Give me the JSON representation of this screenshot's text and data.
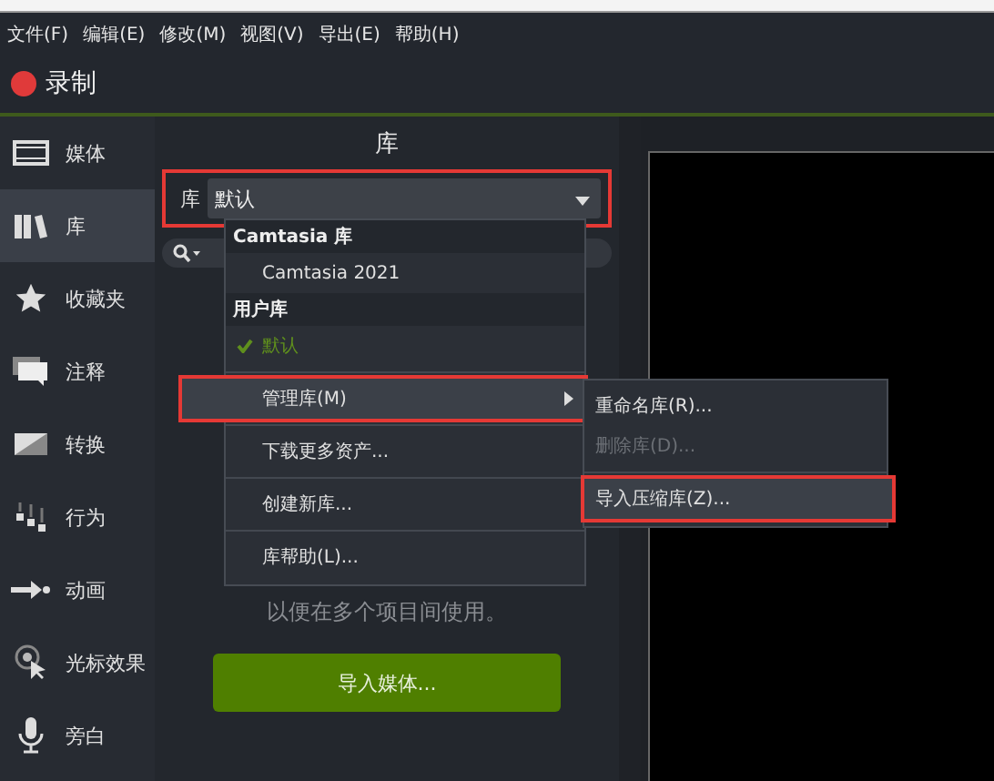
{
  "menubar": [
    "文件(F)",
    "编辑(E)",
    "修改(M)",
    "视图(V)",
    "导出(E)",
    "帮助(H)"
  ],
  "record": {
    "label": "录制"
  },
  "sidebar": {
    "items": [
      {
        "kind": "media",
        "label": "媒体",
        "selected": false
      },
      {
        "kind": "library",
        "label": "库",
        "selected": true
      },
      {
        "kind": "favorites",
        "label": "收藏夹",
        "selected": false
      },
      {
        "kind": "annotations",
        "label": "注释",
        "selected": false
      },
      {
        "kind": "transitions",
        "label": "转换",
        "selected": false
      },
      {
        "kind": "behaviors",
        "label": "行为",
        "selected": false
      },
      {
        "kind": "animations",
        "label": "动画",
        "selected": false
      },
      {
        "kind": "cursor",
        "label": "光标效果",
        "selected": false
      },
      {
        "kind": "voice",
        "label": "旁白",
        "selected": false
      }
    ]
  },
  "library_panel": {
    "title": "库",
    "select_label": "库",
    "select_value": "默认",
    "select_highlighted": true,
    "hint": "以便在多个项目间使用。",
    "import_button": "导入媒体..."
  },
  "dropdown_menu": {
    "items": [
      {
        "kind": "header",
        "label": "Camtasia 库"
      },
      {
        "kind": "item",
        "label": "Camtasia 2021",
        "selected": false
      },
      {
        "kind": "header",
        "label": "用户库"
      },
      {
        "kind": "item",
        "label": "默认",
        "selected": true
      },
      {
        "kind": "separator"
      },
      {
        "kind": "submenu",
        "label": "管理库(M)",
        "highlighted": true
      },
      {
        "kind": "separator"
      },
      {
        "kind": "item",
        "label": "下载更多资产...",
        "selected": false
      },
      {
        "kind": "separator"
      },
      {
        "kind": "item",
        "label": "创建新库...",
        "selected": false
      },
      {
        "kind": "separator"
      },
      {
        "kind": "item",
        "label": "库帮助(L)...",
        "selected": false
      }
    ]
  },
  "submenu": {
    "items": [
      {
        "kind": "item",
        "label": "重命名库(R)...",
        "disabled": false,
        "highlighted": false
      },
      {
        "kind": "item",
        "label": "删除库(D)...",
        "disabled": true,
        "highlighted": false
      },
      {
        "kind": "separator"
      },
      {
        "kind": "item",
        "label": "导入压缩库(Z)...",
        "disabled": false,
        "highlighted": true
      }
    ]
  }
}
